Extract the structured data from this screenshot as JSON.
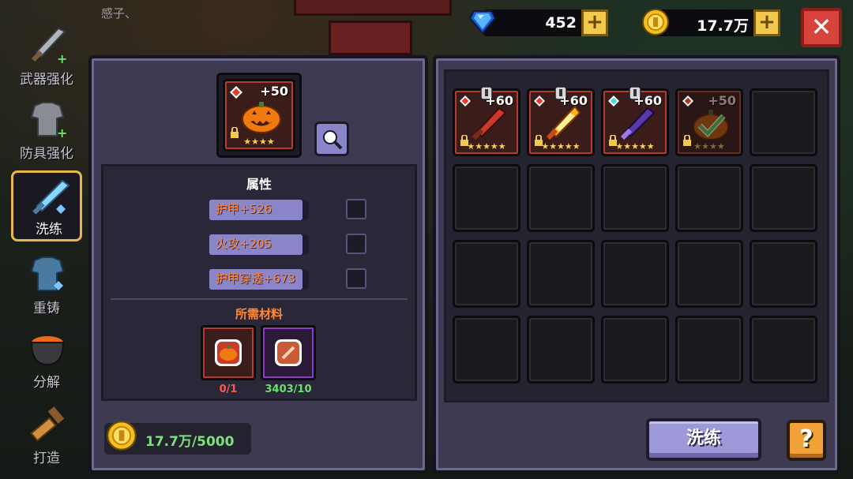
{
  "header": {
    "player_name": "感子、"
  },
  "currency": {
    "gems": "452",
    "gold": "17.7万",
    "plus_label": "+"
  },
  "close_label": "✕",
  "nav": [
    {
      "label": "武器强化"
    },
    {
      "label": "防具强化"
    },
    {
      "label": "洗练",
      "active": true
    },
    {
      "label": "重铸"
    },
    {
      "label": "分解"
    },
    {
      "label": "打造"
    }
  ],
  "selected_item": {
    "level": "+50",
    "stars": "★★★★"
  },
  "attributes": {
    "title": "属性",
    "items": [
      {
        "label": "护甲+526"
      },
      {
        "label": "火攻+205"
      },
      {
        "label": "护甲穿透+673"
      }
    ]
  },
  "materials": {
    "title": "所需材料",
    "items": [
      {
        "count": "0/1",
        "color": "#ff5a4a"
      },
      {
        "count": "3403/10",
        "color": "#6be06b"
      }
    ]
  },
  "cost": "17.7万/5000",
  "inventory": [
    {
      "level": "+60",
      "stars": "★★★★★",
      "type": "sword-red"
    },
    {
      "level": "+60",
      "stars": "★★★★★",
      "type": "sword-fire"
    },
    {
      "level": "+60",
      "stars": "★★★★★",
      "type": "sword-purple"
    },
    {
      "level": "+50",
      "stars": "★★★★",
      "type": "pumpkin-armor",
      "selected": true
    }
  ],
  "buttons": {
    "refine": "洗练",
    "help": "?"
  }
}
